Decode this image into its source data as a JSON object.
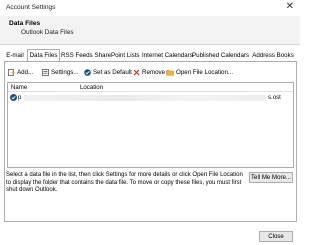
{
  "window": {
    "title": "Account Settings",
    "close_glyph": "✕"
  },
  "header": {
    "title": "Data Files",
    "subtitle": "Outlook Data Files"
  },
  "tabs": [
    {
      "label": "E-mail"
    },
    {
      "label": "Data Files",
      "active": true
    },
    {
      "label": "RSS Feeds"
    },
    {
      "label": "SharePoint Lists"
    },
    {
      "label": "Internet Calendars"
    },
    {
      "label": "Published Calendars"
    },
    {
      "label": "Address Books"
    }
  ],
  "toolbar": {
    "add": "Add...",
    "settings": "Settings...",
    "set_default": "Set as Default",
    "remove": "Remove",
    "open_location": "Open File Location..."
  },
  "list": {
    "columns": [
      "Name",
      "Location"
    ],
    "rows": [
      {
        "name": "p",
        "location": "s.ost",
        "default": true
      }
    ]
  },
  "info_text": "Select a data file in the list, then click Settings for more details or click Open File Location to display the folder that contains the data file. To move or copy these files, you must first shut down Outlook.",
  "buttons": {
    "tell_me_more": "Tell Me More...",
    "close": "Close"
  },
  "colors": {
    "accent": "#1e4d86",
    "remove_x": "#c42b1c",
    "folder": "#e8b63b"
  },
  "icons": {
    "add": "add-file-icon",
    "settings": "settings-icon",
    "default": "checkmark-circle-icon",
    "remove": "remove-icon",
    "folder": "folder-icon"
  }
}
